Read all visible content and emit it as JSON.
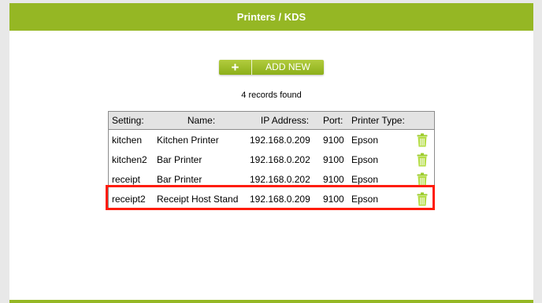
{
  "header": {
    "title": "Printers / KDS"
  },
  "add_button": {
    "icon": "plus-icon",
    "label": "ADD NEW"
  },
  "records_text": "4 records found",
  "table": {
    "columns": [
      "Setting:",
      "Name:",
      "IP Address:",
      "Port:",
      "Printer Type:"
    ],
    "rows": [
      {
        "setting": "kitchen",
        "name": "Kitchen Printer",
        "ip": "192.168.0.209",
        "port": "9100",
        "type": "Epson"
      },
      {
        "setting": "kitchen2",
        "name": "Bar Printer",
        "ip": "192.168.0.202",
        "port": "9100",
        "type": "Epson"
      },
      {
        "setting": "receipt",
        "name": "Bar Printer",
        "ip": "192.168.0.202",
        "port": "9100",
        "type": "Epson"
      },
      {
        "setting": "receipt2",
        "name": "Receipt Host Stand",
        "ip": "192.168.0.209",
        "port": "9100",
        "type": "Epson"
      }
    ],
    "delete_icon": "trash-icon"
  },
  "colors": {
    "accent": "#95b724",
    "highlight": "#ff1c0a"
  }
}
